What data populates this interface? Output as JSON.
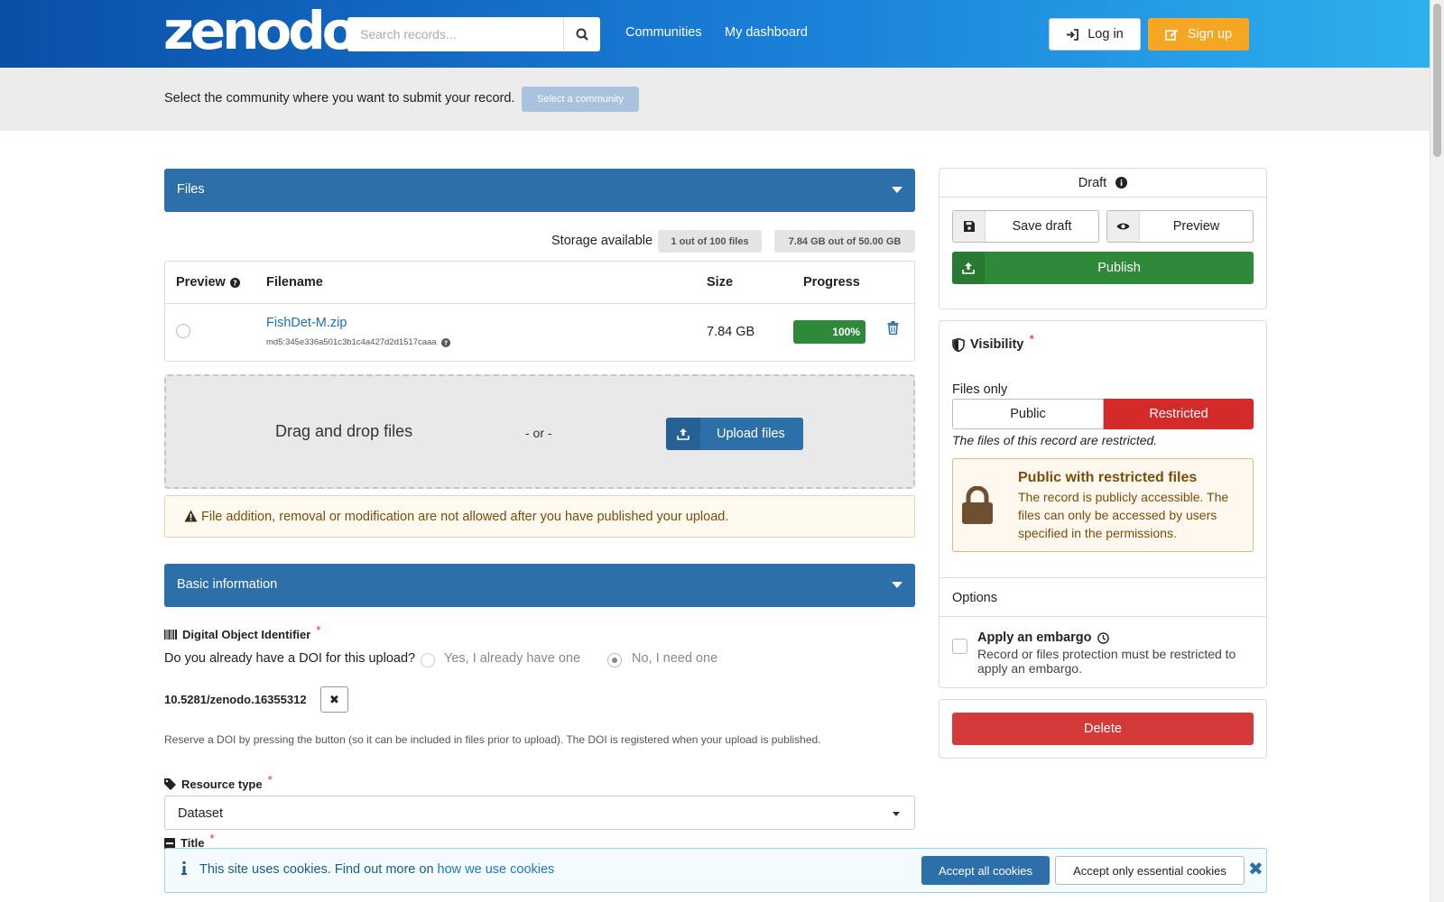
{
  "header": {
    "logo": "zenodo",
    "search_placeholder": "Search records...",
    "nav": [
      "Communities",
      "My dashboard"
    ],
    "login_label": "Log in",
    "signup_label": "Sign up"
  },
  "community": {
    "text": "Select the community where you want to submit your record.",
    "button": "Select a community"
  },
  "files": {
    "section_title": "Files",
    "storage_label": "Storage available",
    "files_pill": "1 out of 100 files",
    "size_pill": "7.84 GB out of 50.00 GB",
    "columns": [
      "Preview",
      "Filename",
      "Size",
      "Progress"
    ],
    "rows": [
      {
        "filename": "FishDet-M.zip",
        "md5": "md5:345e336a501c3b1c4a427d2d1517caaa",
        "size": "7.84 GB",
        "progress": 100,
        "progress_label": "100%"
      }
    ],
    "drop_text": "Drag and drop files",
    "or_text": "- or -",
    "upload_label": "Upload files",
    "warning": "File addition, removal or modification are not allowed after you have published your upload."
  },
  "basic": {
    "section_title": "Basic information",
    "doi_label": "Digital Object Identifier",
    "doi_question": "Do you already have a DOI for this upload?",
    "doi_opt_yes": "Yes, I already have one",
    "doi_opt_no": "No, I need one",
    "doi_value": "10.5281/zenodo.16355312",
    "doi_clear": "✖",
    "doi_help": "Reserve a DOI by pressing the button (so it can be included in files prior to upload). The DOI is registered when your upload is published.",
    "resource_label": "Resource type",
    "resource_value": "Dataset",
    "title_label": "Title",
    "required_mark": "*"
  },
  "sidebar": {
    "draft_label": "Draft",
    "save_label": "Save draft",
    "preview_label": "Preview",
    "publish_label": "Publish",
    "visibility_label": "Visibility",
    "files_only_label": "Files only",
    "public_label": "Public",
    "restricted_label": "Restricted",
    "restricted_note": "The files of this record are restricted.",
    "lock_title": "Public with restricted files",
    "lock_desc": "The record is publicly accessible. The files can only be accessed by users specified in the permissions.",
    "options_label": "Options",
    "embargo_title": "Apply an embargo",
    "embargo_desc": "Record or files protection must be restricted to apply an embargo.",
    "delete_label": "Delete"
  },
  "cookie": {
    "text": "This site uses cookies. Find out more on",
    "link": "how we use cookies",
    "accept_all": "Accept all cookies",
    "accept_essential": "Accept only essential cookies",
    "close": "✖"
  },
  "colors": {
    "header_start": "#0a4fa8",
    "header_end": "#2db0ee",
    "primary": "#2d6fa8",
    "success": "#2e8a3a",
    "danger": "#d42a2a",
    "signup": "#f5a623"
  }
}
